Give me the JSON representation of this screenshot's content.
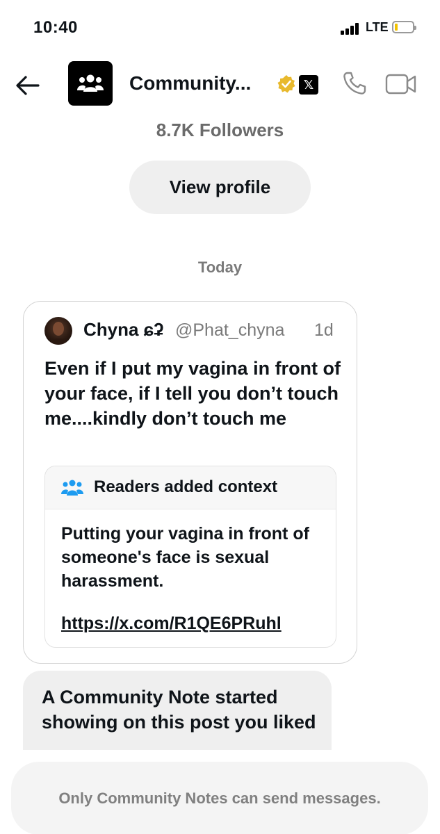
{
  "status_bar": {
    "time": "10:40",
    "network": "LTE",
    "battery_level": 0.15,
    "battery_color": "#f2c200"
  },
  "header": {
    "back_icon": "arrow-left-icon",
    "avatar_icon": "people-group-icon",
    "title": "Community...",
    "verified_color": "#e8b92d",
    "x_badge": "𝕏",
    "phone_icon": "phone-icon",
    "video_icon": "video-camera-icon"
  },
  "profile": {
    "followers": "8.7K Followers",
    "view_profile_label": "View profile"
  },
  "conversation": {
    "date_separator": "Today",
    "quoted_post": {
      "author": "Chyna ɕʡ",
      "handle": "@Phat_chyna",
      "time": "1d",
      "text": "Even if I put my vagina in front of your face, if I tell you don’t touch me....kindly don’t touch me",
      "context": {
        "title": "Readers added context",
        "icon": "people-icon",
        "icon_color": "#1d9bf0",
        "text": "Putting your vagina in front of someone's face is sexual harassment.",
        "link": "https://x.com/R1QE6PRuhl"
      }
    },
    "message": {
      "text": "A Community Note started showing on this post you liked"
    }
  },
  "composer": {
    "disabled_text": "Only Community Notes can send messages."
  }
}
